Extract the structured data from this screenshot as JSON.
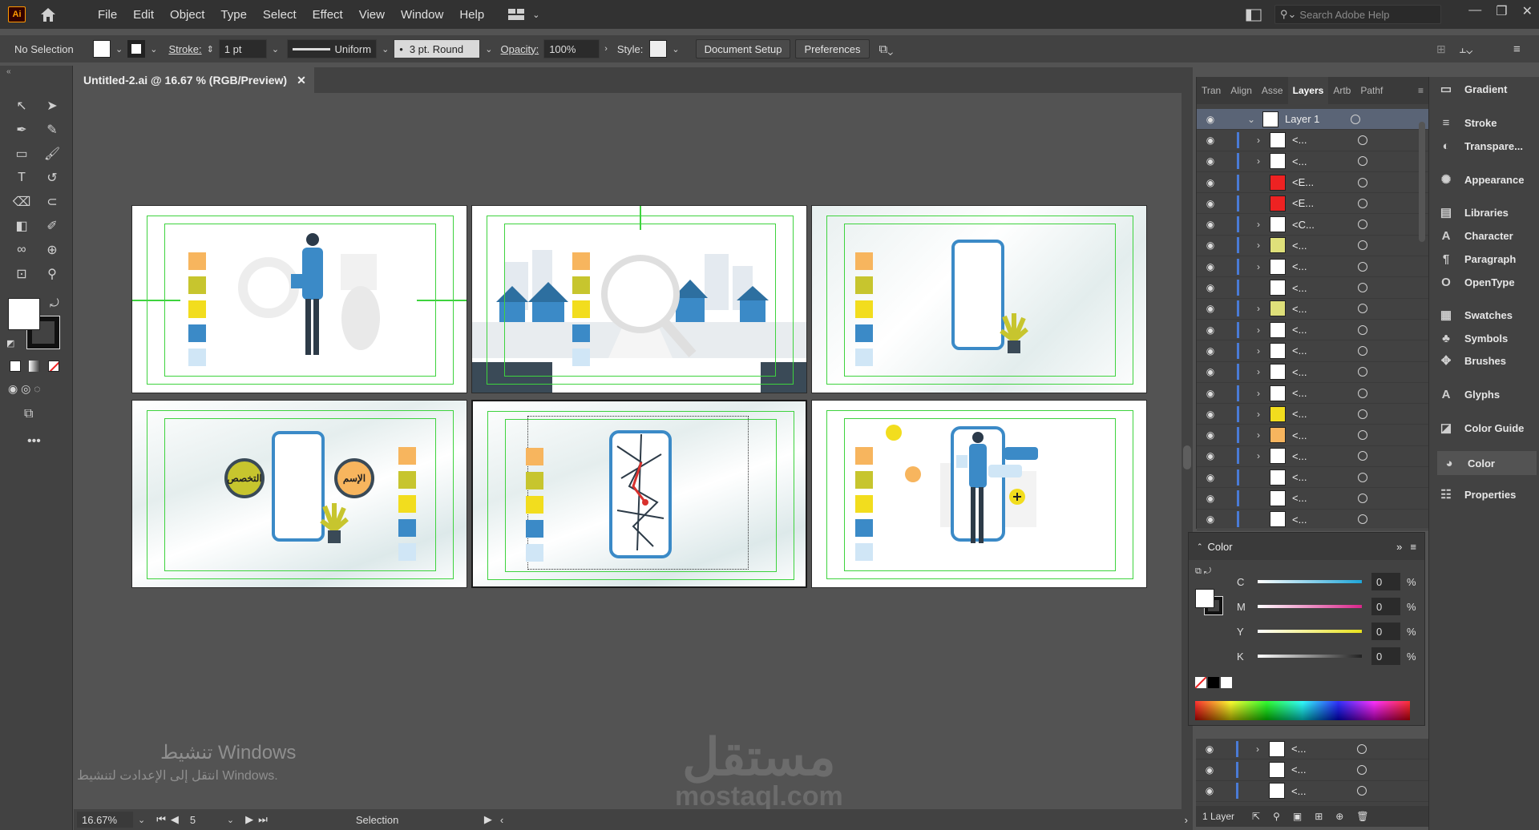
{
  "app": {
    "logo": "Ai"
  },
  "menu": [
    "File",
    "Edit",
    "Object",
    "Type",
    "Select",
    "Effect",
    "View",
    "Window",
    "Help"
  ],
  "search": {
    "placeholder": "Search Adobe Help"
  },
  "control": {
    "selection": "No Selection",
    "stroke_label": "Stroke:",
    "stroke_value": "1 pt",
    "profile": "Uniform",
    "brush": "3 pt. Round",
    "opacity_label": "Opacity:",
    "opacity_value": "100%",
    "style_label": "Style:",
    "doc_setup": "Document Setup",
    "preferences": "Preferences"
  },
  "document": {
    "tab": "Untitled-2.ai @ 16.67 % (RGB/Preview)"
  },
  "status": {
    "zoom": "16.67%",
    "artboard": "5",
    "tool": "Selection"
  },
  "watermark": {
    "line1": "تنشيط Windows",
    "line2": "انتقل إلى الإعدادت لتنشيط Windows.",
    "brand_ar": "مستقل",
    "brand_en": "mostaql.com"
  },
  "artboard_labels": {
    "name": "الإسم",
    "specialty": "التخصص"
  },
  "palette_colors": [
    "#f7b55e",
    "#c7c52e",
    "#f2dd1e",
    "#3b8ac7",
    "#d0e6f6"
  ],
  "layers": {
    "tabs": [
      "Tran",
      "Align",
      "Asse",
      "Layers",
      "Artb",
      "Pathf"
    ],
    "active_tab": "Layers",
    "top_layer": "Layer 1",
    "items": [
      "<...",
      "<...",
      "<E...",
      "<E...",
      "<C...",
      "<...",
      "<...",
      "<...",
      "<...",
      "<...",
      "<...",
      "<...",
      "<...",
      "<...",
      "<...",
      "<...",
      "<...",
      "<...",
      "<..."
    ],
    "bottom_items": [
      "<...",
      "<...",
      "<..."
    ],
    "count": "1 Layer"
  },
  "color_panel": {
    "title": "Color",
    "channels": [
      {
        "name": "C",
        "value": "0",
        "color": "#1ea6d9"
      },
      {
        "name": "M",
        "value": "0",
        "color": "#d9258a"
      },
      {
        "name": "Y",
        "value": "0",
        "color": "#e8e21c"
      },
      {
        "name": "K",
        "value": "0",
        "color": "#222222"
      }
    ],
    "unit": "%"
  },
  "dock": [
    "Gradient",
    "Stroke",
    "Transpare...",
    "Appearance",
    "Libraries",
    "Character",
    "Paragraph",
    "OpenType",
    "Swatches",
    "Symbols",
    "Brushes",
    "Glyphs",
    "Color Guide",
    "Color",
    "Properties"
  ],
  "dock_active": "Color"
}
